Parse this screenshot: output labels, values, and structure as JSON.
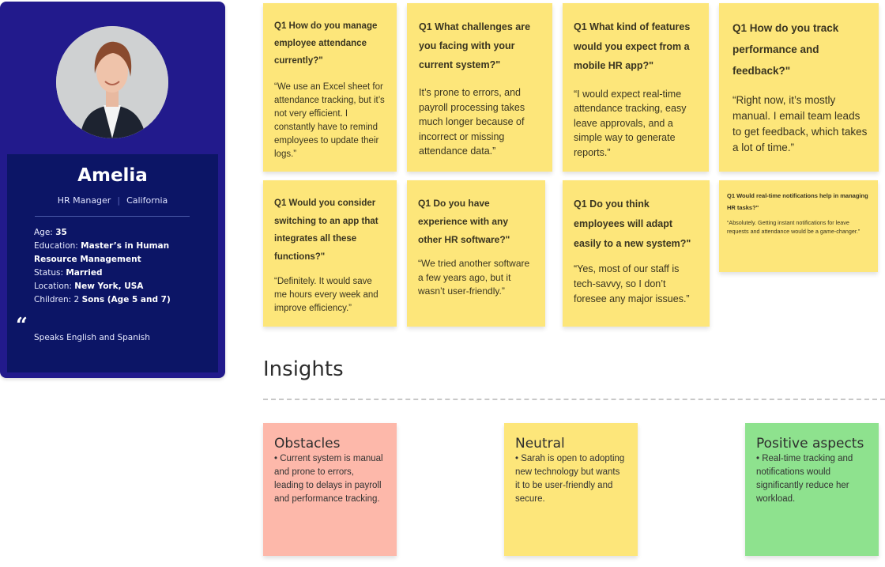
{
  "persona": {
    "name": "Amelia",
    "role": "HR Manager",
    "region": "California",
    "details": [
      {
        "label": "Age: ",
        "value": "35"
      },
      {
        "label": "Education: ",
        "value": "Master’s in Human Resource Management"
      },
      {
        "label": "Status: ",
        "value": "Married"
      },
      {
        "label": "Location: ",
        "value": "New York, USA"
      },
      {
        "label": "Children: 2 ",
        "value": "Sons (Age 5 and 7)"
      }
    ],
    "quote_mark": "“",
    "quote": "Speaks English and Spanish",
    "colors": {
      "card": "#221a8c",
      "inner": "#0c1566"
    }
  },
  "interview_notes": [
    {
      "qnum": "Q1",
      "question": "How do you manage employee attendance currently?\"",
      "answer": "“We use an Excel sheet for attendance tracking, but it’s not very efficient. I constantly have to remind employees to update their logs.”"
    },
    {
      "qnum": "Q1",
      "question": "What challenges are you facing with your current system?\"",
      "answer": "It’s prone to errors, and payroll processing takes much longer because of incorrect or missing attendance data.”"
    },
    {
      "qnum": "Q1",
      "question": "What kind of features would you expect from a mobile HR app?\"",
      "answer": "“I would expect real-time attendance tracking, easy leave approvals, and a simple way to generate reports.”"
    },
    {
      "qnum": "Q1",
      "question": "How do you track performance and feedback?\"",
      "answer": "“Right now, it’s mostly manual. I email team leads to get feedback, which takes a lot of time.”"
    },
    {
      "qnum": "Q1",
      "question": "Would you consider switching to an app that integrates all these functions?\"",
      "answer": "“Definitely. It would save me hours every week and improve efficiency.”"
    },
    {
      "qnum": "Q1",
      "question": "Do you have experience with any other HR software?\"",
      "answer": "“We tried another software a few years ago, but it wasn’t user-friendly.”"
    },
    {
      "qnum": "Q1",
      "question": "Do you think employees will adapt easily to a new system?\"",
      "answer": "“Yes, most of our staff is tech-savvy, so I don’t foresee any major issues.”"
    },
    {
      "qnum": "Q1",
      "question": "Would real-time notifications help in managing HR tasks?\"",
      "answer": "“Absolutely. Getting instant notifications for leave requests and attendance would be a game-changer.”"
    }
  ],
  "insights": {
    "title": "Insights",
    "cards": [
      {
        "title": "Obstacles",
        "body": "• Current system is manual and prone to errors, leading to delays in payroll and performance tracking.",
        "color": "#fdb8aa"
      },
      {
        "title": "Neutral",
        "body": "• Sarah is open to adopting new technology but wants it to be user-friendly and secure.",
        "color": "#fde67a"
      },
      {
        "title": "Positive aspects",
        "body": "• Real-time tracking and notifications would significantly reduce her workload.",
        "color": "#8ee28e"
      }
    ]
  },
  "note_color": "#fde67a"
}
